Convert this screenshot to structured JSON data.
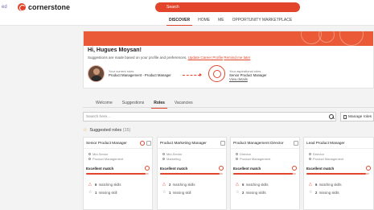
{
  "header": {
    "logo_ed": "ed",
    "logo_text": "cornerstone",
    "search_placeholder": "Search",
    "nav": [
      "DISCOVER",
      "HOME",
      "ME",
      "OPPORTUNITY MARKETPLACE"
    ],
    "active_nav": "DISCOVER"
  },
  "hero": {
    "greeting": "Hi, Hugues Moysan!",
    "subtitle": "Suggestions are made based on your profile and preferences.",
    "update_link": "Update Career Profile",
    "remind_link": "Remind me later",
    "current_label": "Your current roles",
    "current_value": "Product Management - Product Manager",
    "aspirational_label": "Your aspirational roles",
    "aspirational_value": "Senior Product Manager",
    "view_details": "View details"
  },
  "tabs": [
    "Welcome",
    "Suggestions",
    "Roles",
    "Vacancies"
  ],
  "active_tab": "Roles",
  "search": {
    "placeholder": "Search here...",
    "manage_label": "Manage roles"
  },
  "suggested": {
    "title": "Suggested roles",
    "count": "(15)"
  },
  "cards": [
    {
      "title": "Senior Product Manager",
      "level": "Mid-Senior",
      "area": "Product Management",
      "match": "Excellent match",
      "match_level": 0.95,
      "matching": "6",
      "matching_label": "matching skills",
      "missing": "1",
      "missing_label": "missing skill"
    },
    {
      "title": "Product Marketing Manager",
      "level": "Mid-Senior",
      "area": "Marketing",
      "match": "Excellent match",
      "match_level": 0.95,
      "matching": "2",
      "matching_label": "matching skills",
      "missing": "1",
      "missing_label": "missing skill"
    },
    {
      "title": "Product Management Director",
      "level": "Director",
      "area": "Product Management",
      "match": "Excellent match",
      "match_level": 0.95,
      "matching": "6",
      "matching_label": "matching skills",
      "missing": "2",
      "missing_label": "missing skills"
    },
    {
      "title": "Lead Product Manager",
      "level": "Director",
      "area": "Product Management",
      "match": "Excellent match",
      "match_level": 0.95,
      "matching": "6",
      "matching_label": "matching skills",
      "missing": "2",
      "missing_label": "missing skills"
    }
  ],
  "colors": {
    "accent": "#e2452b",
    "hero_band": "#ea5a36"
  }
}
